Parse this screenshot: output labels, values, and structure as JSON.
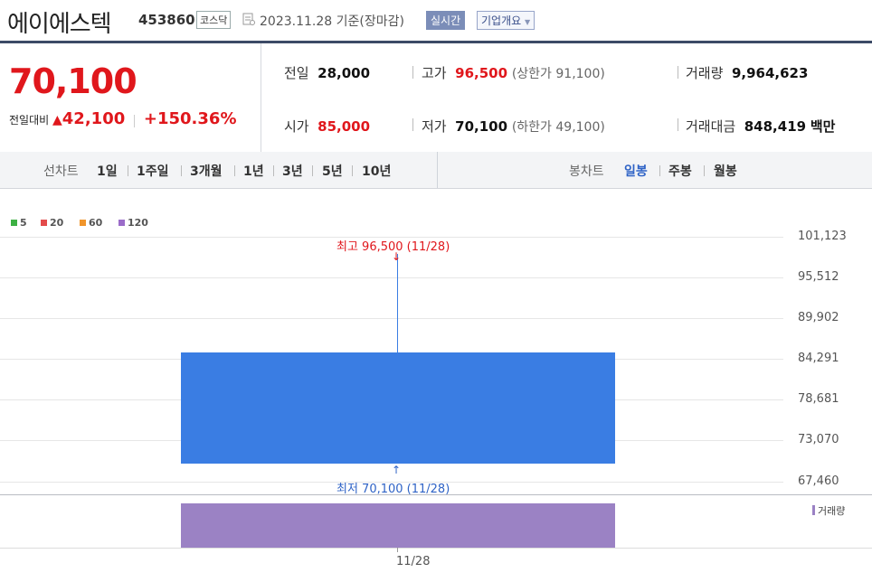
{
  "header": {
    "name": "에이에스텍",
    "code": "453860",
    "market": "코스닥",
    "date": "2023.11.28 기준(장마감)",
    "realtime": "실시간",
    "corp_overview": "기업개요"
  },
  "price": {
    "current": "70,100",
    "diff_label": "전일대비",
    "diff_arrow": "▲",
    "diff_value": "42,100",
    "diff_rate": "+150.36%"
  },
  "stats": {
    "prev_label": "전일",
    "prev_value": "28,000",
    "high_label": "고가",
    "high_value": "96,500",
    "upper_limit": "(상한가 91,100)",
    "volume_label": "거래량",
    "volume_value": "9,964,623",
    "open_label": "시가",
    "open_value": "85,000",
    "low_label": "저가",
    "low_value": "70,100",
    "lower_limit": "(하한가 49,100)",
    "amount_label": "거래대금",
    "amount_value": "848,419",
    "amount_unit": "백만"
  },
  "period_tabs": {
    "line_chart_label": "선차트",
    "items": [
      "1일",
      "1주일",
      "3개월",
      "1년",
      "3년",
      "5년",
      "10년"
    ],
    "candle_chart_label": "봉차트",
    "candle_items": [
      "일봉",
      "주봉",
      "월봉"
    ],
    "candle_active": "일봉"
  },
  "legend": [
    {
      "label": "5",
      "color": "#3cb043"
    },
    {
      "label": "20",
      "color": "#e34b4b"
    },
    {
      "label": "60",
      "color": "#f0952b"
    },
    {
      "label": "120",
      "color": "#9b6cc9"
    }
  ],
  "chart_data": {
    "type": "candlestick",
    "y_ticks": [
      "101,123",
      "95,512",
      "89,902",
      "84,291",
      "78,681",
      "73,070",
      "67,460"
    ],
    "x_ticks": [
      "11/28"
    ],
    "candles": [
      {
        "date": "11/28",
        "open": 85000,
        "high": 96500,
        "low": 70100,
        "close": 70100
      }
    ],
    "high_annotation": "최고 96,500 (11/28)",
    "low_annotation": "최저 70,100 (11/28)",
    "volume_label": "거래량",
    "colors": {
      "candle": "#3a7de3",
      "volume": "#9b82c4",
      "up": "#e0171c",
      "down": "#2f63c6"
    }
  }
}
